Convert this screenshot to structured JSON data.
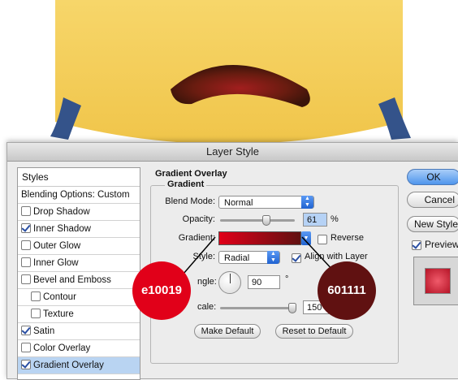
{
  "dialog": {
    "title": "Layer Style"
  },
  "styles_panel": {
    "header": "Styles",
    "items": [
      {
        "label": "Blending Options: Custom",
        "checkbox": false,
        "checked": false,
        "indent": false,
        "selected": false
      },
      {
        "label": "Drop Shadow",
        "checkbox": true,
        "checked": false,
        "indent": false,
        "selected": false
      },
      {
        "label": "Inner Shadow",
        "checkbox": true,
        "checked": true,
        "indent": false,
        "selected": false
      },
      {
        "label": "Outer Glow",
        "checkbox": true,
        "checked": false,
        "indent": false,
        "selected": false
      },
      {
        "label": "Inner Glow",
        "checkbox": true,
        "checked": false,
        "indent": false,
        "selected": false
      },
      {
        "label": "Bevel and Emboss",
        "checkbox": true,
        "checked": false,
        "indent": false,
        "selected": false
      },
      {
        "label": "Contour",
        "checkbox": true,
        "checked": false,
        "indent": true,
        "selected": false
      },
      {
        "label": "Texture",
        "checkbox": true,
        "checked": false,
        "indent": true,
        "selected": false
      },
      {
        "label": "Satin",
        "checkbox": true,
        "checked": true,
        "indent": false,
        "selected": false
      },
      {
        "label": "Color Overlay",
        "checkbox": true,
        "checked": false,
        "indent": false,
        "selected": false
      },
      {
        "label": "Gradient Overlay",
        "checkbox": true,
        "checked": true,
        "indent": false,
        "selected": true
      }
    ]
  },
  "gradient_overlay": {
    "section_title": "Gradient Overlay",
    "group_title": "Gradient",
    "blend_mode_label": "Blend Mode:",
    "blend_mode_value": "Normal",
    "opacity_label": "Opacity:",
    "opacity_value": "61",
    "opacity_unit": "%",
    "opacity_fraction": 0.61,
    "gradient_label": "Gradient:",
    "gradient_colors": [
      "#e10019",
      "#601111"
    ],
    "reverse_label": "Reverse",
    "reverse_checked": false,
    "style_label": "Style:",
    "style_value": "Radial",
    "align_label": "Align with Layer",
    "align_checked": true,
    "angle_label": "ngle:",
    "angle_value": "90",
    "angle_unit": "°",
    "scale_label": "cale:",
    "scale_value": "150",
    "scale_fraction": 1.0,
    "make_default_label": "Make Default",
    "reset_default_label": "Reset to Default"
  },
  "side_buttons": {
    "ok_label": "OK",
    "cancel_label": "Cancel",
    "new_style_label": "New Style",
    "preview_label": "Preview",
    "preview_checked": true
  },
  "annotations": {
    "start_color_label": "e10019",
    "end_color_label": "601111",
    "start_color": "#e10019",
    "end_color": "#601111"
  }
}
